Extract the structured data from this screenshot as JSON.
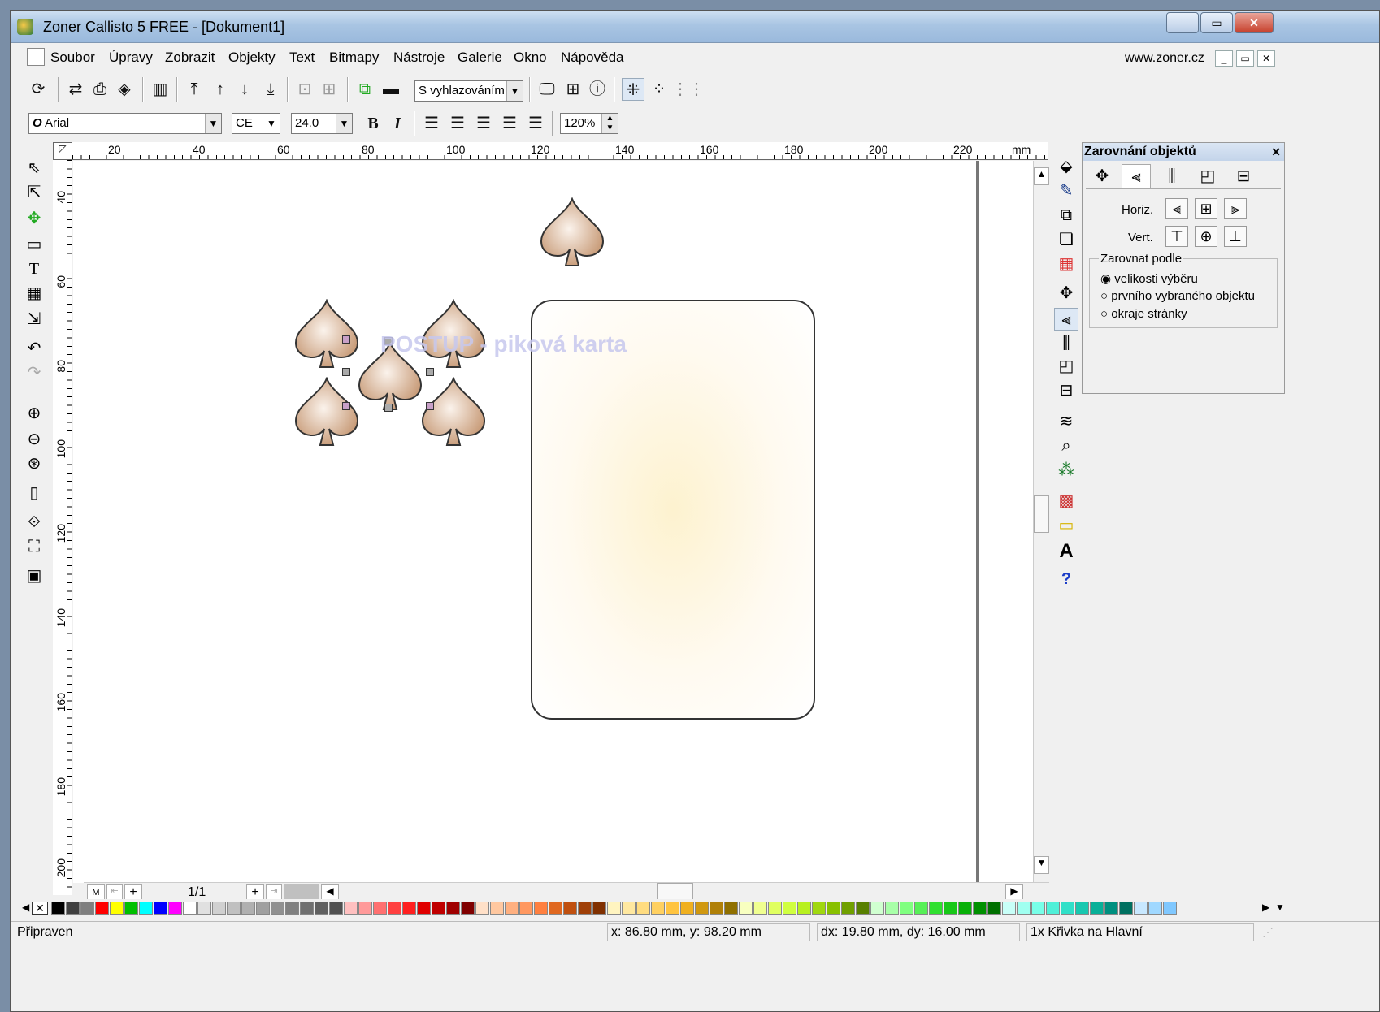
{
  "window": {
    "title": "Zoner Callisto 5 FREE - [Dokument1]",
    "min": "–",
    "max": "▭",
    "close": "✕"
  },
  "menu": {
    "items": [
      "Soubor",
      "Úpravy",
      "Zobrazit",
      "Objekty",
      "Text",
      "Bitmapy",
      "Nástroje",
      "Galerie",
      "Okno",
      "Nápověda"
    ],
    "website": "www.zoner.cz"
  },
  "toolbar1": {
    "smoothing_value": "S vyhlazováním"
  },
  "toolbar2": {
    "font_value": "Arial",
    "charset_value": "CE",
    "size_value": "24.0",
    "bold": "B",
    "italic": "I",
    "zoom_value": "120%"
  },
  "ruler_top": {
    "unit": "mm",
    "labels": [
      "20",
      "40",
      "60",
      "80",
      "100",
      "120",
      "140",
      "160",
      "180",
      "200",
      "220"
    ]
  },
  "ruler_left": {
    "labels": [
      "40",
      "60",
      "80",
      "100",
      "120",
      "140",
      "160",
      "180",
      "200"
    ]
  },
  "canvas": {
    "watermark": "POSTUP - piková karta",
    "spade_color": "#d6b39a"
  },
  "page_nav": {
    "first": "M",
    "counter": "1/1"
  },
  "panel": {
    "title": "Zarovnání objektů",
    "horiz_label": "Horiz.",
    "vert_label": "Vert.",
    "group_title": "Zarovnat podle",
    "options": [
      "velikosti výběru",
      "prvního vybraného objektu",
      "okraje stránky"
    ],
    "selected_option": "velikosti výběru"
  },
  "palette": {
    "colors": [
      "#000000",
      "#404040",
      "#7f7f7f",
      "#ff0000",
      "#ffff00",
      "#00c000",
      "#00ffff",
      "#0000ff",
      "#ff00ff",
      "#ffffff",
      "#e0e0e0",
      "#d0d0d0",
      "#c0c0c0",
      "#b0b0b0",
      "#a0a0a0",
      "#909090",
      "#808080",
      "#707070",
      "#606060",
      "#505050",
      "#ffc0c0",
      "#ff9a9a",
      "#ff7070",
      "#ff4040",
      "#ff2020",
      "#e00000",
      "#c00000",
      "#a00000",
      "#800000",
      "#ffe0c8",
      "#ffc8a0",
      "#ffb080",
      "#ff9860",
      "#ff8040",
      "#e06820",
      "#c05010",
      "#a04008",
      "#803000",
      "#fff4c0",
      "#ffe8a0",
      "#ffdc80",
      "#ffd060",
      "#ffc440",
      "#f0b020",
      "#d09810",
      "#b08008",
      "#907000",
      "#f8ffc0",
      "#f0ff90",
      "#e0ff60",
      "#d0ff40",
      "#b8f020",
      "#a0d810",
      "#88c000",
      "#70a000",
      "#588000",
      "#d0ffd0",
      "#a8ffa8",
      "#80ff80",
      "#58f058",
      "#30e030",
      "#18c818",
      "#08b008",
      "#009000",
      "#007000",
      "#c8fff8",
      "#a0fff0",
      "#78ffe8",
      "#50f0d8",
      "#30e0c8",
      "#18c8b0",
      "#08b098",
      "#009080",
      "#007060",
      "#c8e8ff",
      "#a0d8ff",
      "#80c8ff"
    ]
  },
  "status": {
    "state": "Připraven",
    "coords": "x: 86.80 mm, y: 98.20 mm",
    "delta": "dx: 19.80 mm, dy: 16.00 mm",
    "selection": "1x Křivka na Hlavní"
  }
}
